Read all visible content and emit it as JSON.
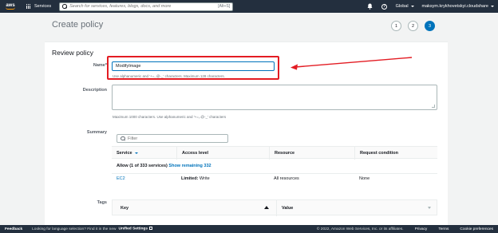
{
  "topnav": {
    "logo_text": "aws",
    "services_label": "Services",
    "search_placeholder": "Search for services, features, blogs, docs, and more",
    "search_shortcut": "[Alt+S]",
    "region_label": "Global",
    "account_label": "maksym.krykhovetskyi.cloudshare"
  },
  "page": {
    "title": "Create policy",
    "steps": [
      "1",
      "2",
      "3"
    ],
    "active_step": "3",
    "section_title": "Review policy"
  },
  "form": {
    "name_label": "Name*",
    "name_value": "ModifyImage",
    "name_hint": "Use alphanumeric and '+=,.@-_' characters. Maximum 128 characters.",
    "description_label": "Description",
    "description_value": "",
    "description_hint": "Maximum 1000 characters. Use alphanumeric and '+=,.@-_' characters",
    "summary_label": "Summary",
    "tags_label": "Tags"
  },
  "summary": {
    "filter_placeholder": "Filter",
    "columns": [
      "Service",
      "Access level",
      "Resource",
      "Request condition"
    ],
    "group_text": "Allow (1 of 333 services)",
    "group_link": "Show remaining 332",
    "rows": [
      {
        "service": "EC2",
        "access_level": "Limited:",
        "access_detail": " Write",
        "resource": "All resources",
        "condition": "None"
      }
    ]
  },
  "tags": {
    "columns": [
      "Key",
      "Value"
    ]
  },
  "footer": {
    "feedback": "Feedback",
    "language_text": "Looking for language selection? Find it in the new",
    "unified_settings": "Unified Settings",
    "copyright": "© 2022, Amazon Web Services, Inc. or its affiliates.",
    "privacy": "Privacy",
    "terms": "Terms",
    "cookie": "Cookie preferences"
  },
  "colors": {
    "nav_bg": "#232f3e",
    "accent": "#0073bb",
    "annotation_red": "#e31c23",
    "page_bg": "#f2f3f3"
  }
}
